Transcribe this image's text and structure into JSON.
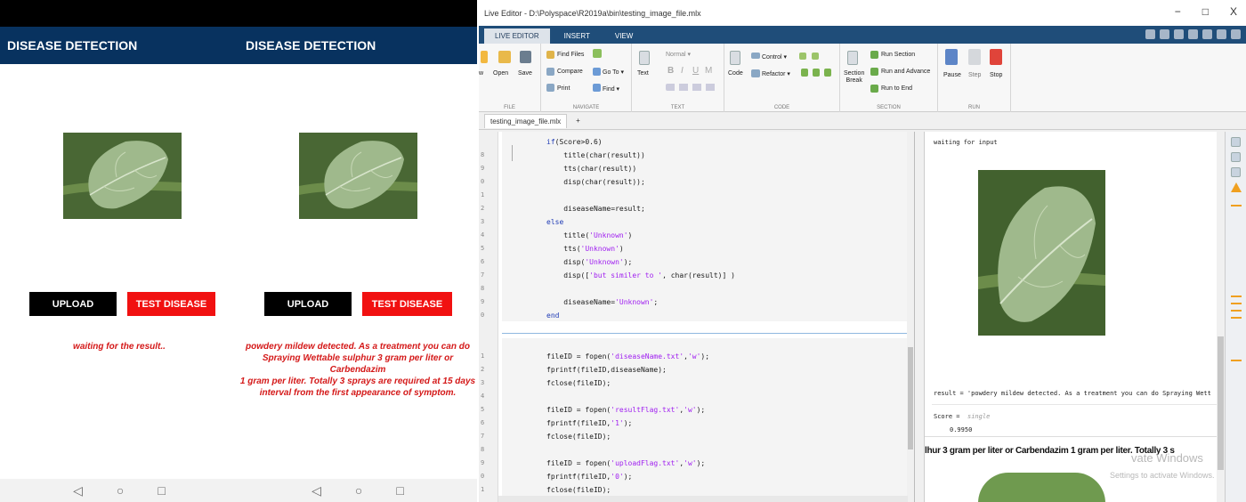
{
  "phones": [
    {
      "title": "DISEASE DETECTION",
      "upload_label": "UPLOAD",
      "test_label": "TEST DISEASE",
      "message_lines": [
        "waiting for the result.."
      ]
    },
    {
      "title": "DISEASE DETECTION",
      "upload_label": "UPLOAD",
      "test_label": "TEST DISEASE",
      "message_lines": [
        "powdery mildew detected. As a treatment you can do",
        "Spraying Wettable sulphur 3 gram per liter or Carbendazim",
        "1 gram per liter. Totally 3 sprays are required at 15 days",
        "interval from the first appearance of symptom."
      ]
    }
  ],
  "nav_icons": [
    "back-icon",
    "home-icon",
    "recents-icon"
  ],
  "matlab": {
    "window_title": "Live Editor - D:\\Polyspace\\R2019a\\bin\\testing_image_file.mlx",
    "window_controls": [
      "−",
      "□",
      "X"
    ],
    "tabs": [
      "LIVE EDITOR",
      "INSERT",
      "VIEW"
    ],
    "ribbon": {
      "file": {
        "label": "FILE",
        "open": "Open",
        "save": "Save",
        "new": "w"
      },
      "navigate": {
        "label": "NAVIGATE",
        "find_files": "Find Files",
        "compare": "Compare",
        "print": "Print",
        "goto": "Go To ▾",
        "find": "Find ▾"
      },
      "text": {
        "label": "TEXT",
        "text": "Text",
        "normal": "Normal ▾",
        "bold": "B",
        "italic": "I",
        "underline": "U",
        "mono": "M"
      },
      "code": {
        "label": "CODE",
        "code": "Code",
        "control": "Control ▾",
        "refactor": "Refactor ▾"
      },
      "section": {
        "label": "SECTION",
        "break": "Section\nBreak",
        "run_section": "Run Section",
        "run_advance": "Run and Advance",
        "run_end": "Run to End"
      },
      "run": {
        "label": "RUN",
        "pause": "Pause",
        "step": "Step",
        "stop": "Stop"
      }
    },
    "file_tab": "testing_image_file.mlx",
    "file_tab_add": "+",
    "code_block1": [
      {
        "n": "",
        "t": "if(Score>0.6)"
      },
      {
        "n": "8",
        "t": "    title(char(result))"
      },
      {
        "n": "9",
        "t": "    tts(char(result))"
      },
      {
        "n": "0",
        "t": "    disp(char(result));"
      },
      {
        "n": "1",
        "t": ""
      },
      {
        "n": "2",
        "t": "    diseaseName=result;"
      },
      {
        "n": "3",
        "t": "else"
      },
      {
        "n": "4",
        "t": "    title('Unknown')"
      },
      {
        "n": "5",
        "t": "    tts('Unknown')"
      },
      {
        "n": "6",
        "t": "    disp('Unknown');"
      },
      {
        "n": "7",
        "t": "    disp(['but similer to ', char(result)] )"
      },
      {
        "n": "8",
        "t": ""
      },
      {
        "n": "9",
        "t": "    diseaseName='Unknown';"
      },
      {
        "n": "0",
        "t": "end"
      }
    ],
    "code_block2": [
      {
        "n": "1",
        "t": "fileID = fopen('diseaseName.txt','w');"
      },
      {
        "n": "2",
        "t": "fprintf(fileID,diseaseName);"
      },
      {
        "n": "3",
        "t": "fclose(fileID);"
      },
      {
        "n": "4",
        "t": ""
      },
      {
        "n": "5",
        "t": "fileID = fopen('resultFlag.txt','w');"
      },
      {
        "n": "6",
        "t": "fprintf(fileID,'1');"
      },
      {
        "n": "7",
        "t": "fclose(fileID);"
      },
      {
        "n": "8",
        "t": ""
      },
      {
        "n": "9",
        "t": "fileID = fopen('uploadFlag.txt','w');"
      },
      {
        "n": "0",
        "t": "fprintf(fileID,'0');"
      },
      {
        "n": "1",
        "t": "fclose(fileID);"
      }
    ],
    "output": {
      "waiting": "waiting for input",
      "result_line": "result = 'powdery mildew detected. As a treatment you can do Spraying Wett",
      "score_label": "Score =",
      "score_type": "single",
      "score_value": "0.9950",
      "wrapped_text": "lhur 3 gram per liter or Carbendazim 1 gram per liter. Totally 3 s",
      "watermark1": "vate Windows",
      "watermark2": "Settings to activate Windows."
    }
  }
}
